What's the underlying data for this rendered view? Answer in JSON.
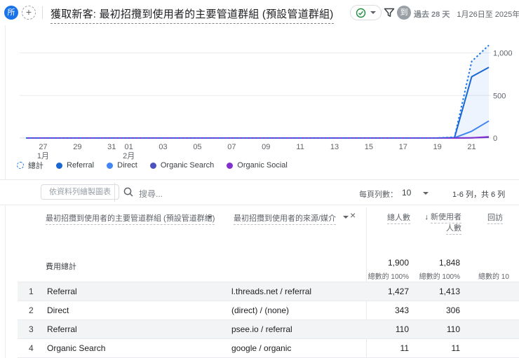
{
  "header": {
    "all_chip": "所",
    "add_chip": "+",
    "title": "獲取新客: 最初招攬到使用者的主要管道群組 (預設管道群組)",
    "avatar_badge": "到",
    "period_label": "過去 28 天",
    "period_dates": "1月26日至 2025年2月2",
    "accent_color": "#1a73e8",
    "check_color": "#1e8e3e"
  },
  "chart_data": {
    "type": "line",
    "title": "",
    "xlabel": "",
    "ylabel": "",
    "x": [
      "1月26日",
      "1月27日",
      "1月28日",
      "1月29日",
      "1月30日",
      "1月31日",
      "2月1日",
      "2月2日",
      "2月3日",
      "2月4日",
      "2月5日",
      "2月6日",
      "2月7日",
      "2月8日",
      "2月9日",
      "2月10日",
      "2月11日",
      "2月12日",
      "2月13日",
      "2月14日",
      "2月15日",
      "2月16日",
      "2月17日",
      "2月18日",
      "2月19日",
      "2月20日",
      "2月21日",
      "2月22日"
    ],
    "x_ticks": [
      {
        "i": 1,
        "label": "27",
        "sub": "1月"
      },
      {
        "i": 3,
        "label": "29"
      },
      {
        "i": 5,
        "label": "31"
      },
      {
        "i": 6,
        "label": "01",
        "sub": "2月"
      },
      {
        "i": 8,
        "label": "03"
      },
      {
        "i": 10,
        "label": "05"
      },
      {
        "i": 12,
        "label": "07"
      },
      {
        "i": 14,
        "label": "09"
      },
      {
        "i": 16,
        "label": "11"
      },
      {
        "i": 18,
        "label": "13"
      },
      {
        "i": 20,
        "label": "15"
      },
      {
        "i": 22,
        "label": "17"
      },
      {
        "i": 24,
        "label": "19"
      },
      {
        "i": 26,
        "label": "21"
      }
    ],
    "y_ticks": [
      0,
      500,
      1000
    ],
    "y_tick_labels": [
      "0",
      "500",
      "1,000"
    ],
    "ylim": [
      0,
      1150
    ],
    "grid": true,
    "legend_position": "bottom-left",
    "fill_color": "rgba(26,115,232,0.08)",
    "series": [
      {
        "name": "總計",
        "color": "#1a73e8",
        "line_style": "dotted",
        "values": [
          0,
          0,
          0,
          0,
          0,
          0,
          0,
          0,
          0,
          0,
          0,
          0,
          0,
          0,
          0,
          0,
          0,
          0,
          0,
          0,
          0,
          0,
          0,
          0,
          0,
          10,
          900,
          1090
        ]
      },
      {
        "name": "Referral",
        "color": "#1967d2",
        "line_style": "solid",
        "values": [
          0,
          0,
          0,
          0,
          0,
          0,
          0,
          0,
          0,
          0,
          0,
          0,
          0,
          0,
          0,
          0,
          0,
          0,
          0,
          0,
          0,
          0,
          0,
          0,
          0,
          5,
          720,
          830
        ]
      },
      {
        "name": "Direct",
        "color": "#4285f4",
        "line_style": "solid",
        "values": [
          0,
          0,
          0,
          0,
          0,
          0,
          0,
          0,
          0,
          0,
          0,
          0,
          0,
          0,
          0,
          0,
          0,
          0,
          0,
          0,
          0,
          0,
          0,
          0,
          0,
          3,
          80,
          200
        ]
      },
      {
        "name": "Organic Search",
        "color": "#4c52bf",
        "line_style": "solid",
        "values": [
          0,
          0,
          0,
          0,
          0,
          0,
          0,
          0,
          0,
          0,
          0,
          0,
          0,
          0,
          0,
          0,
          0,
          0,
          0,
          0,
          0,
          0,
          0,
          0,
          0,
          0,
          2,
          8
        ]
      },
      {
        "name": "Organic Social",
        "color": "#8430ce",
        "line_style": "solid",
        "values": [
          0,
          0,
          0,
          0,
          0,
          0,
          0,
          0,
          0,
          0,
          0,
          0,
          0,
          0,
          0,
          0,
          0,
          0,
          0,
          0,
          0,
          0,
          0,
          0,
          0,
          0,
          2,
          14
        ]
      }
    ]
  },
  "toolbar": {
    "plot_rows_button": "依資料列繪製圖表",
    "search_placeholder": "搜尋...",
    "rows_per_page_label": "每頁列數：",
    "rows_per_page_value": "10",
    "pagination": "1-6 列，共 6 列"
  },
  "table": {
    "dim_col1": "最初招攬到使用者的主要管道群組 (預設管道群組)",
    "dim_col2": "最初招攬到使用者的來源/媒介",
    "metric_col1": "總人數",
    "metric_col2_line1": "新使用者",
    "metric_col2_line2": "人數",
    "metric_col2_sort_arrow": "↓",
    "metric_col3": "回訪",
    "totals_label": "費用總計",
    "totals": {
      "users": "1,900",
      "users_pct": "總數的 100%",
      "new_users": "1,848",
      "new_users_pct": "總數的 100%",
      "third_pct": "總數的 10"
    },
    "rows": [
      {
        "n": "1",
        "channel": "Referral",
        "source": "l.threads.net / referral",
        "users": "1,427",
        "new_users": "1,413"
      },
      {
        "n": "2",
        "channel": "Direct",
        "source": "(direct) / (none)",
        "users": "343",
        "new_users": "306"
      },
      {
        "n": "3",
        "channel": "Referral",
        "source": "psee.io / referral",
        "users": "110",
        "new_users": "110"
      },
      {
        "n": "4",
        "channel": "Organic Search",
        "source": "google / organic",
        "users": "11",
        "new_users": "11"
      }
    ]
  }
}
